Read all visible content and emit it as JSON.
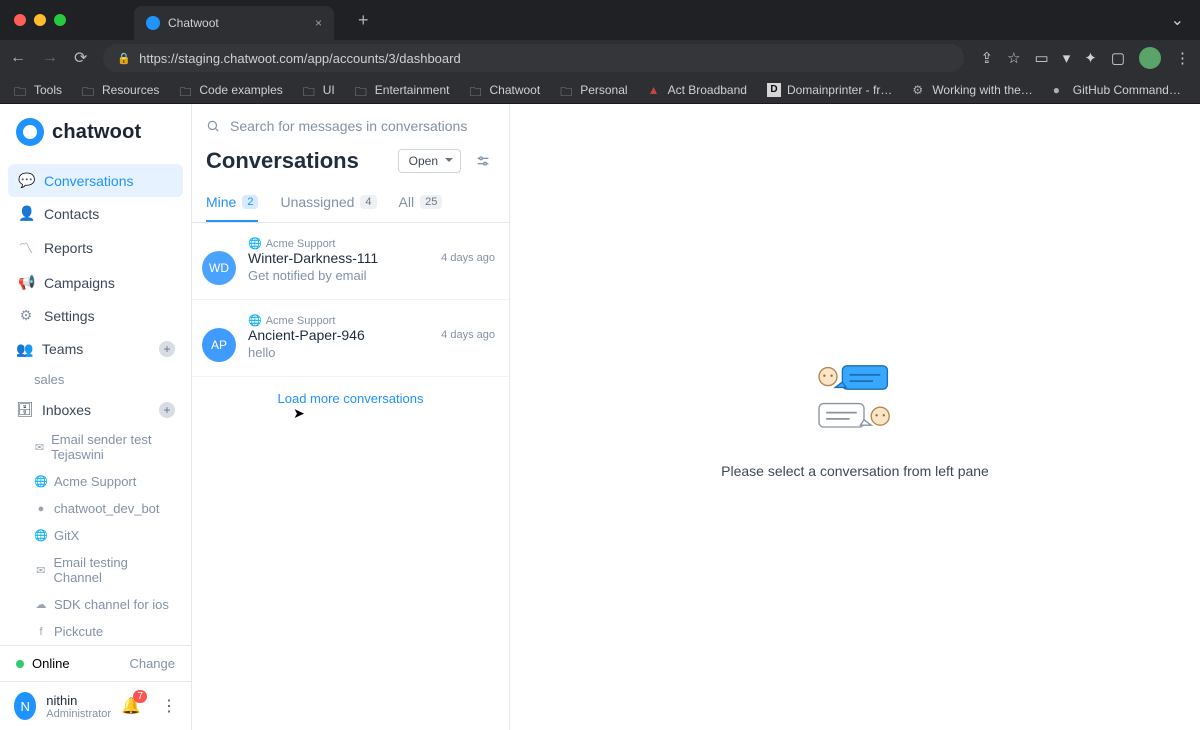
{
  "browser": {
    "tab_title": "Chatwoot",
    "url": "https://staging.chatwoot.com/app/accounts/3/dashboard",
    "bookmarks": [
      "Tools",
      "Resources",
      "Code examples",
      "UI",
      "Entertainment",
      "Chatwoot",
      "Personal",
      "Act Broadband",
      "Domainprinter - fr…",
      "Working with the…",
      "GitHub Command…"
    ]
  },
  "app": {
    "logo_text": "chatwoot",
    "nav": {
      "conversations": "Conversations",
      "contacts": "Contacts",
      "reports": "Reports",
      "campaigns": "Campaigns",
      "settings": "Settings"
    },
    "teams": {
      "label": "Teams",
      "items": [
        "sales"
      ]
    },
    "inboxes": {
      "label": "Inboxes",
      "items": [
        {
          "icon": "mail",
          "label": "Email sender test Tejaswini"
        },
        {
          "icon": "globe",
          "label": "Acme Support"
        },
        {
          "icon": "dot",
          "label": "chatwoot_dev_bot"
        },
        {
          "icon": "globe",
          "label": "GitX"
        },
        {
          "icon": "mail",
          "label": "Email testing Channel"
        },
        {
          "icon": "cloud",
          "label": "SDK channel for ios"
        },
        {
          "icon": "fb",
          "label": "Pickcute"
        }
      ]
    },
    "status": {
      "label": "Online",
      "change": "Change"
    },
    "user": {
      "initial": "N",
      "name": "nithin",
      "role": "Administrator",
      "notif_count": "7"
    }
  },
  "center": {
    "search_placeholder": "Search for messages in conversations",
    "heading": "Conversations",
    "filter_dropdown": "Open",
    "tabs": {
      "mine": {
        "label": "Mine",
        "count": "2"
      },
      "unassigned": {
        "label": "Unassigned",
        "count": "4"
      },
      "all": {
        "label": "All",
        "count": "25"
      }
    },
    "conversations": [
      {
        "avatar": "WD",
        "avatar_color": "#4aa3ff",
        "inbox": "Acme Support",
        "name": "Winter-Darkness-111",
        "time": "4 days ago",
        "preview": "Get notified by email"
      },
      {
        "avatar": "AP",
        "avatar_color": "#3f9bff",
        "inbox": "Acme Support",
        "name": "Ancient-Paper-946",
        "time": "4 days ago",
        "preview": "hello"
      }
    ],
    "load_more": "Load more conversations"
  },
  "right": {
    "empty_text": "Please select a conversation from left pane"
  }
}
